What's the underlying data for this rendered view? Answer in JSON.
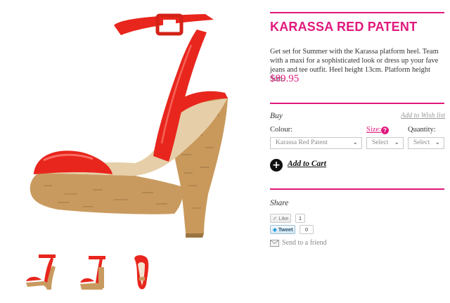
{
  "product": {
    "title": "KARASSA RED PATENT",
    "description": "Get set for Summer with the Karassa platform heel. Team with a maxi for a sophisticated look or dress up your fave jeans and tee outfit. Heel height 13cm. Platform height 5cm.",
    "price": "$89.95"
  },
  "buy": {
    "heading": "Buy",
    "wishlist_link": "Add to Wish list",
    "colour_label": "Colour:",
    "colour_value": "Karassa Red Patent",
    "size_label": "Size:",
    "size_help_icon": "?",
    "size_value": "Select",
    "quantity_label": "Quantity:",
    "quantity_value": "Select",
    "add_to_cart": "Add to Cart",
    "add_icon": "+"
  },
  "share": {
    "heading": "Share",
    "like_label": "Like",
    "like_count": "1",
    "tweet_label": "Tweet",
    "tweet_count": "0",
    "send_to_friend": "Send to a friend"
  },
  "colors": {
    "accent": "#e0197d",
    "shoe_red": "#e8261d",
    "cork": "#c99a5f"
  },
  "icons": {
    "checkmark": "check-icon",
    "bird": "twitter-bird-icon",
    "mail": "mail-icon",
    "chevron": "chevron-down-icon"
  }
}
